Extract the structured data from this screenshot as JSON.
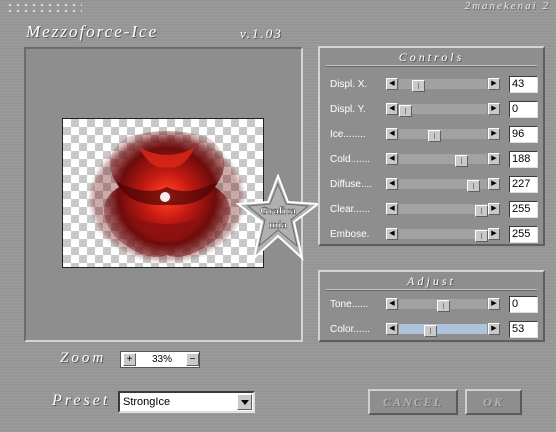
{
  "header": {
    "app_title": "Mezzoforce-Ice",
    "version": "v.1.03",
    "brand": "2manekenai 2"
  },
  "preview": {
    "watermark_line1": "Grafica",
    "watermark_line2": "mia"
  },
  "controls": {
    "title": "Controls",
    "sliders": [
      {
        "label": "Displ. X.",
        "value": "43",
        "fraction": 0.169
      },
      {
        "label": "Displ. Y.",
        "value": "0",
        "fraction": 0.0
      },
      {
        "label": "Ice........",
        "value": "96",
        "fraction": 0.376
      },
      {
        "label": "Cold.......",
        "value": "188",
        "fraction": 0.737
      },
      {
        "label": "Diffuse....",
        "value": "227",
        "fraction": 0.89
      },
      {
        "label": "Clear......",
        "value": "255",
        "fraction": 1.0
      },
      {
        "label": "Embose.",
        "value": "255",
        "fraction": 1.0
      }
    ]
  },
  "adjust": {
    "title": "Adjust",
    "sliders": [
      {
        "label": "Tone......",
        "value": "0",
        "fraction": 0.5
      },
      {
        "label": "Color......",
        "value": "53",
        "fraction": 0.33
      }
    ]
  },
  "zoom": {
    "label": "Zoom",
    "value": "33%",
    "plus": "+",
    "minus": "−"
  },
  "preset": {
    "label": "Preset",
    "value": "StrongIce"
  },
  "buttons": {
    "cancel": "CANCEL",
    "ok": "OK"
  },
  "colors": {
    "background": "#999999",
    "flower_dark": "#6e0c0c",
    "flower_red": "#c41a12",
    "flower_bright": "#ff3a20",
    "highlight_track": "#aec4dc"
  }
}
